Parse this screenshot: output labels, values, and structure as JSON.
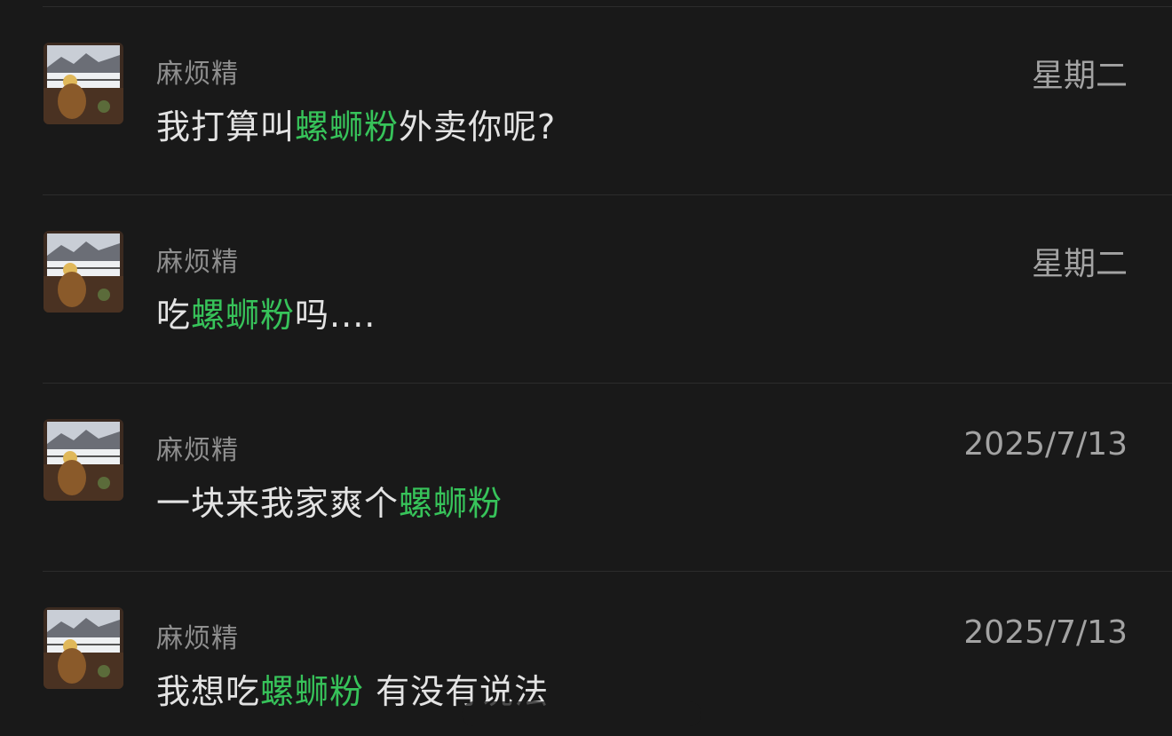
{
  "results": [
    {
      "sender": "麻烦精",
      "time": "星期二",
      "message": {
        "before": "我打算叫",
        "highlight": "螺蛳粉",
        "after": "外卖你呢?"
      }
    },
    {
      "sender": "麻烦精",
      "time": "星期二",
      "message": {
        "before": "吃",
        "highlight": "螺蛳粉",
        "after": "吗...."
      }
    },
    {
      "sender": "麻烦精",
      "time": "2025/7/13",
      "message": {
        "before": "一块来我家爽个",
        "highlight": "螺蛳粉",
        "after": ""
      }
    },
    {
      "sender": "麻烦精",
      "time": "2025/7/13",
      "message": {
        "before": "我想吃",
        "highlight": "螺蛳粉",
        "after": " 有没有说法"
      }
    }
  ],
  "colors": {
    "background": "#191919",
    "highlight": "#37c35a",
    "sender": "#8f8f8f",
    "time": "#a3a3a3",
    "message": "#e3e3e3"
  },
  "icons": {
    "avatar": "avatar-image"
  }
}
